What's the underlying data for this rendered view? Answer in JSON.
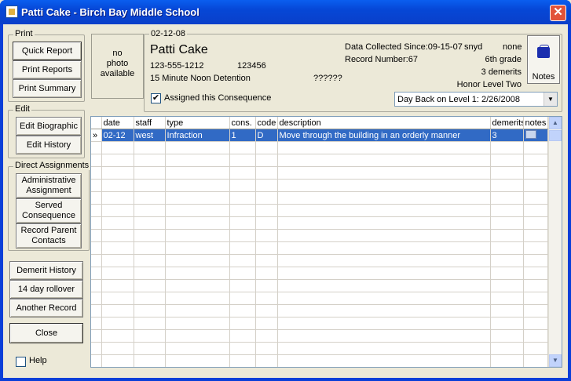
{
  "window": {
    "title": "Patti Cake - Birch Bay Middle School",
    "close_glyph": "✕"
  },
  "groups": {
    "print": "Print",
    "edit": "Edit",
    "direct": "Direct Assignments"
  },
  "buttons": {
    "quick_report": "Quick Report",
    "print_reports": "Print Reports",
    "print_summary": "Print Summary",
    "edit_biographic": "Edit Biographic",
    "edit_history": "Edit History",
    "administrative_assignment_1": "Administrative",
    "administrative_assignment_2": "Assignment",
    "served_consequence_1": "Served",
    "served_consequence_2": "Consequence",
    "record_parent_contacts_1": "Record Parent",
    "record_parent_contacts_2": "Contacts",
    "demerit_history": "Demerit History",
    "day_rollover": "14 day rollover",
    "another_record": "Another Record",
    "close": "Close",
    "notes": "Notes"
  },
  "help": {
    "label": "Help",
    "checked": false
  },
  "photo": {
    "line1": "no",
    "line2": "photo",
    "line3": "available"
  },
  "student": {
    "date": "02-12-08",
    "name": "Patti Cake",
    "phone": "123-555-1212",
    "id": "123456",
    "consequence": "15 Minute Noon Detention",
    "unknown": "??????",
    "data_collected": "Data Collected Since:09-15-07",
    "code": "snyd",
    "none": "none",
    "record_number": "Record Number:67",
    "grade": "6th grade",
    "demerits": "3 demerits",
    "honor_level": "Honor Level Two",
    "assigned_label": "Assigned this Consequence",
    "assigned_checked": true,
    "day_back": "Day Back on Level 1: 2/26/2008"
  },
  "grid": {
    "columns": [
      "date",
      "staff",
      "type",
      "cons.",
      "code",
      "description",
      "demerits",
      "notes"
    ],
    "rows": [
      {
        "indicator": "»",
        "date": "02-12",
        "staff": "west",
        "type": "Infraction",
        "cons": "1",
        "code": "D",
        "description": "Move through the building in an orderly manner",
        "demerits": "3",
        "notes": ""
      }
    ]
  },
  "colors": {
    "titlebar": "#0A4FDE",
    "selection": "#316AC5",
    "face": "#ECE9D8"
  }
}
